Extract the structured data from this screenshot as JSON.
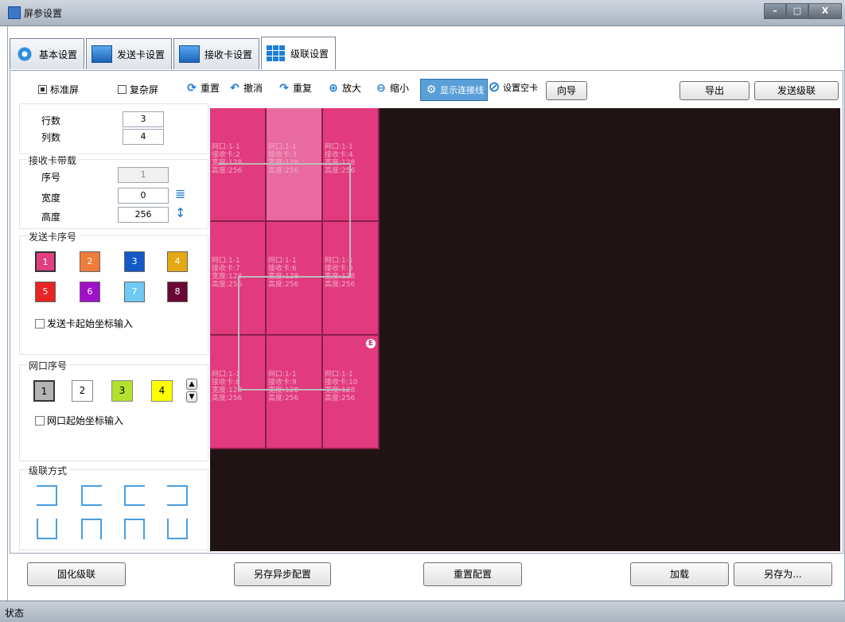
{
  "window": {
    "title": "屏参设置",
    "min": "–",
    "max": "□",
    "close": "X"
  },
  "tabs": [
    {
      "label": "基本设置"
    },
    {
      "label": "发送卡设置"
    },
    {
      "label": "接收卡设置"
    },
    {
      "label": "级联设置"
    }
  ],
  "toolbar": {
    "standard_screen": "标准屏",
    "complex_screen": "复杂屏",
    "reset": "重置",
    "undo": "撤消",
    "redo": "重复",
    "zoom_in": "放大",
    "zoom_out": "缩小",
    "show_wiring": "显示连接线",
    "set_empty": "设置空卡",
    "guide": "向导",
    "export": "导出",
    "send_cascade": "发送级联"
  },
  "sidebar": {
    "rows_label": "行数",
    "rows_value": "3",
    "cols_label": "列数",
    "cols_value": "4",
    "receiver_load_title": "接收卡带载",
    "index_label": "序号",
    "index_value": "1",
    "width_label": "宽度",
    "width_value": "0",
    "height_label": "高度",
    "height_value": "256",
    "sender_index_title": "发送卡序号",
    "sender_colors": [
      {
        "num": "1",
        "color": "#e0407f"
      },
      {
        "num": "2",
        "color": "#ef7c3a"
      },
      {
        "num": "3",
        "color": "#1359c8"
      },
      {
        "num": "4",
        "color": "#e3a812"
      },
      {
        "num": "5",
        "color": "#e82424"
      },
      {
        "num": "6",
        "color": "#a010c8"
      },
      {
        "num": "7",
        "color": "#6fc9f3"
      },
      {
        "num": "8",
        "color": "#6a0835"
      }
    ],
    "sender_start_coord": "发送卡起始坐标输入",
    "port_title": "网口序号",
    "ports": [
      {
        "num": "1",
        "color": "#b4b4b4"
      },
      {
        "num": "2",
        "color": "#ffffff"
      },
      {
        "num": "3",
        "color": "#b4e02e"
      },
      {
        "num": "4",
        "color": "#ffff00"
      }
    ],
    "port_start_coord": "网口起始坐标输入",
    "cascade_mode_title": "级联方式"
  },
  "grid": {
    "cells": [
      {
        "port": "网口:1-1",
        "card": "接收卡:2",
        "w": "宽度:128",
        "h": "高度:256"
      },
      {
        "port": "网口:1-1",
        "card": "接收卡:3",
        "w": "宽度:128",
        "h": "高度:256"
      },
      {
        "port": "网口:1-1",
        "card": "接收卡:4",
        "w": "宽度:128",
        "h": "高度:256"
      },
      {
        "port": "网口:1-1",
        "card": "接收卡:7",
        "w": "宽度:128",
        "h": "高度:256"
      },
      {
        "port": "网口:1-1",
        "card": "接收卡:6",
        "w": "宽度:128",
        "h": "高度:256"
      },
      {
        "port": "网口:1-1",
        "card": "接收卡:5",
        "w": "宽度:128",
        "h": "高度:256"
      },
      {
        "port": "网口:1-1",
        "card": "接收卡:8",
        "w": "宽度:128",
        "h": "高度:256"
      },
      {
        "port": "网口:1-1",
        "card": "接收卡:9",
        "w": "宽度:128",
        "h": "高度:256"
      },
      {
        "port": "网口:1-1",
        "card": "接收卡:10",
        "w": "宽度:128",
        "h": "高度:256"
      }
    ],
    "end_marker": "E"
  },
  "bottom": {
    "solidify": "固化级联",
    "save_async": "另存异步配置",
    "reset_config": "重置配置",
    "load": "加载",
    "save_as": "另存为..."
  },
  "status": {
    "label": "状态"
  }
}
